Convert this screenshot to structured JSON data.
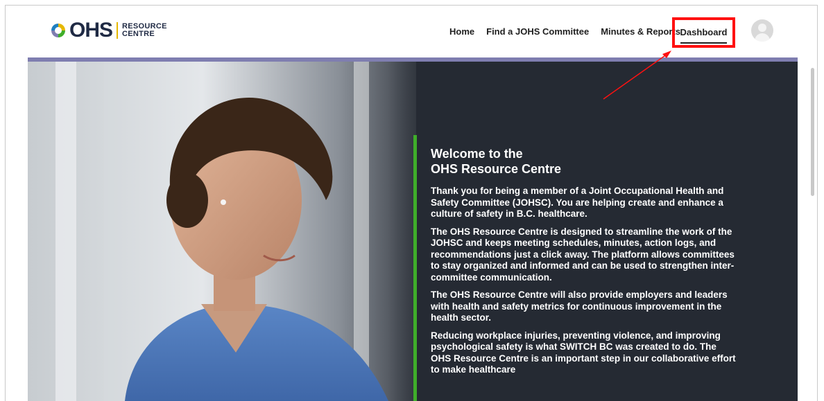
{
  "logo": {
    "ohs": "OHS",
    "line1": "RESOURCE",
    "line2": "CENTRE"
  },
  "nav": {
    "items": [
      "Home",
      "Find a JOHS Committee",
      "Minutes & Reports"
    ],
    "dashboard": "Dashboard"
  },
  "colors": {
    "accent_purple": "#7f7eb0",
    "accent_green": "#3fae2a",
    "highlight_red": "#ff1111",
    "hero_dark": "#252a33"
  },
  "hero": {
    "title_line1": "Welcome to the",
    "title_line2": "OHS Resource Centre",
    "paragraphs": [
      "Thank you for being a member of a Joint Occupational Health and Safety Committee (JOHSC). You are helping create and enhance a culture of safety in B.C. healthcare.",
      "The OHS Resource Centre is designed to streamline the work of the JOHSC and keeps meeting schedules, minutes, action logs, and recommendations just a click away. The platform allows committees to stay organized and informed and can be used to strengthen inter-committee communication.",
      "The OHS Resource Centre will also provide employers and leaders with health and safety metrics for continuous improvement in the health sector.",
      "Reducing workplace injuries, preventing violence, and improving psychological safety is what SWITCH BC was created to do. The OHS Resource Centre is an important step in our collaborative effort to make healthcare"
    ]
  }
}
